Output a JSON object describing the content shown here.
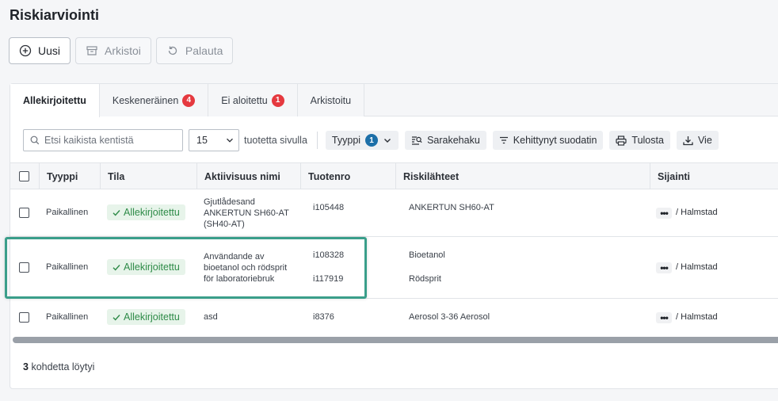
{
  "page": {
    "title": "Riskiarviointi"
  },
  "toolbar": {
    "new_label": "Uusi",
    "archive_label": "Arkistoi",
    "restore_label": "Palauta"
  },
  "tabs": [
    {
      "label": "Allekirjoitettu",
      "badge": ""
    },
    {
      "label": "Keskeneräinen",
      "badge": "4"
    },
    {
      "label": "Ei aloitettu",
      "badge": "1"
    },
    {
      "label": "Arkistoitu",
      "badge": ""
    }
  ],
  "filters": {
    "search_placeholder": "Etsi kaikista kentistä",
    "per_page_value": "15",
    "per_page_label": "tuotetta sivulla",
    "type_label": "Tyyppi",
    "type_count": "1",
    "column_search_label": "Sarakehaku",
    "advanced_filter_label": "Kehittynyt suodatin",
    "print_label": "Tulosta",
    "export_label": "Vie"
  },
  "table": {
    "headers": {
      "type": "Tyyppi",
      "status": "Tila",
      "activity": "Aktiivisuus nimi",
      "product_no": "Tuotenro",
      "risk_sources": "Riskilähteet",
      "location": "Sijainti"
    },
    "rows": [
      {
        "type": "Paikallinen",
        "status": "Allekirjoitettu",
        "activity": "Gjutlådesand ANKERTUN SH60-AT (SH40-AT)",
        "products": [
          "i105448"
        ],
        "sources": [
          "ANKERTUN SH60-AT"
        ],
        "location": "Halmstad"
      },
      {
        "type": "Paikallinen",
        "status": "Allekirjoitettu",
        "activity": "Användande av bioetanol och rödsprit för laboratoriebruk",
        "products": [
          "i108328",
          "i117919"
        ],
        "sources": [
          "Bioetanol",
          "Rödsprit"
        ],
        "location": "Halmstad"
      },
      {
        "type": "Paikallinen",
        "status": "Allekirjoitettu",
        "activity": "asd",
        "products": [
          "i8376"
        ],
        "sources": [
          "Aerosol 3-36 Aerosol"
        ],
        "location": "Halmstad"
      }
    ]
  },
  "footer": {
    "count": "3",
    "label": "kohdetta löytyi"
  },
  "colors": {
    "accent_blue": "#1c6fa8",
    "status_green": "#2e8b48",
    "badge_red": "#e5393f",
    "highlight": "#3a9e8a"
  }
}
